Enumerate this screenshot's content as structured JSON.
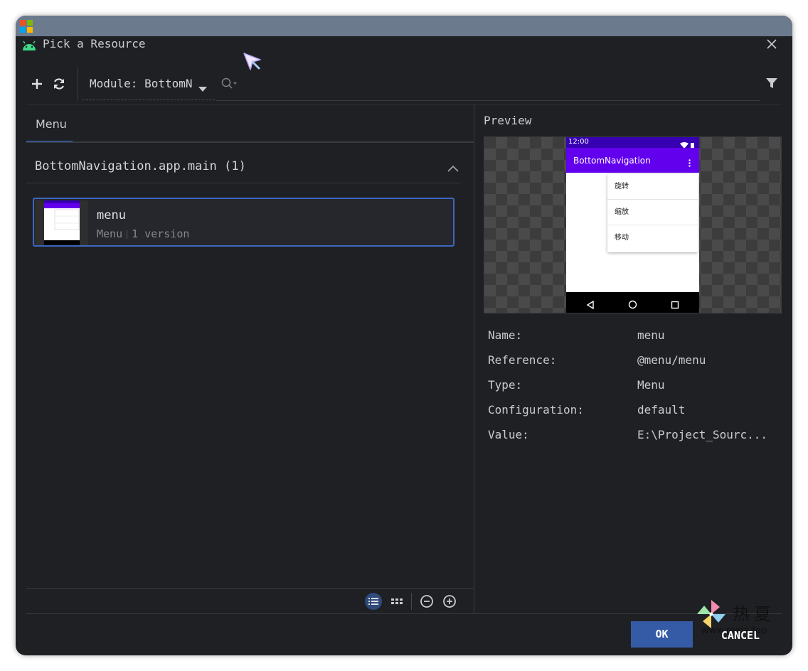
{
  "dialog": {
    "title": "Pick a Resource"
  },
  "toolbar": {
    "add_icon": "plus-icon",
    "refresh_icon": "refresh-icon",
    "module_label": "Module: BottomN",
    "search_placeholder": "",
    "filter_icon": "filter-icon"
  },
  "tabs": [
    {
      "label": "Menu",
      "selected": true
    }
  ],
  "group": {
    "title": "BottomNavigation.app.main (1)",
    "expanded": true
  },
  "resources": [
    {
      "name": "menu",
      "type": "Menu",
      "versions": "1 version",
      "selected": true
    }
  ],
  "preview": {
    "label": "Preview",
    "phone": {
      "time": "12:00",
      "app_title": "BottomNavigation",
      "menu_items": [
        "旋转",
        "缩放",
        "移动"
      ]
    }
  },
  "properties": [
    {
      "key": "Name:",
      "value": "menu"
    },
    {
      "key": "Reference:",
      "value": "@menu/menu"
    },
    {
      "key": "Type:",
      "value": "Menu"
    },
    {
      "key": "Configuration:",
      "value": "default"
    },
    {
      "key": "Value:",
      "value": "E:\\Project_Sourc..."
    }
  ],
  "view_controls": [
    "list-view-icon",
    "grid-view-icon",
    "zoom-out-icon",
    "zoom-in-icon"
  ],
  "buttons": {
    "ok": "OK",
    "cancel": "CANCEL"
  },
  "watermark": {
    "text": "热夏",
    "url": "www.rexia.top"
  },
  "colors": {
    "accent": "#3574f0",
    "ok_button": "#365ba6",
    "selection_border": "#3d66c0",
    "app_bar": "#6200ee",
    "status_bar": "#3700b3"
  }
}
